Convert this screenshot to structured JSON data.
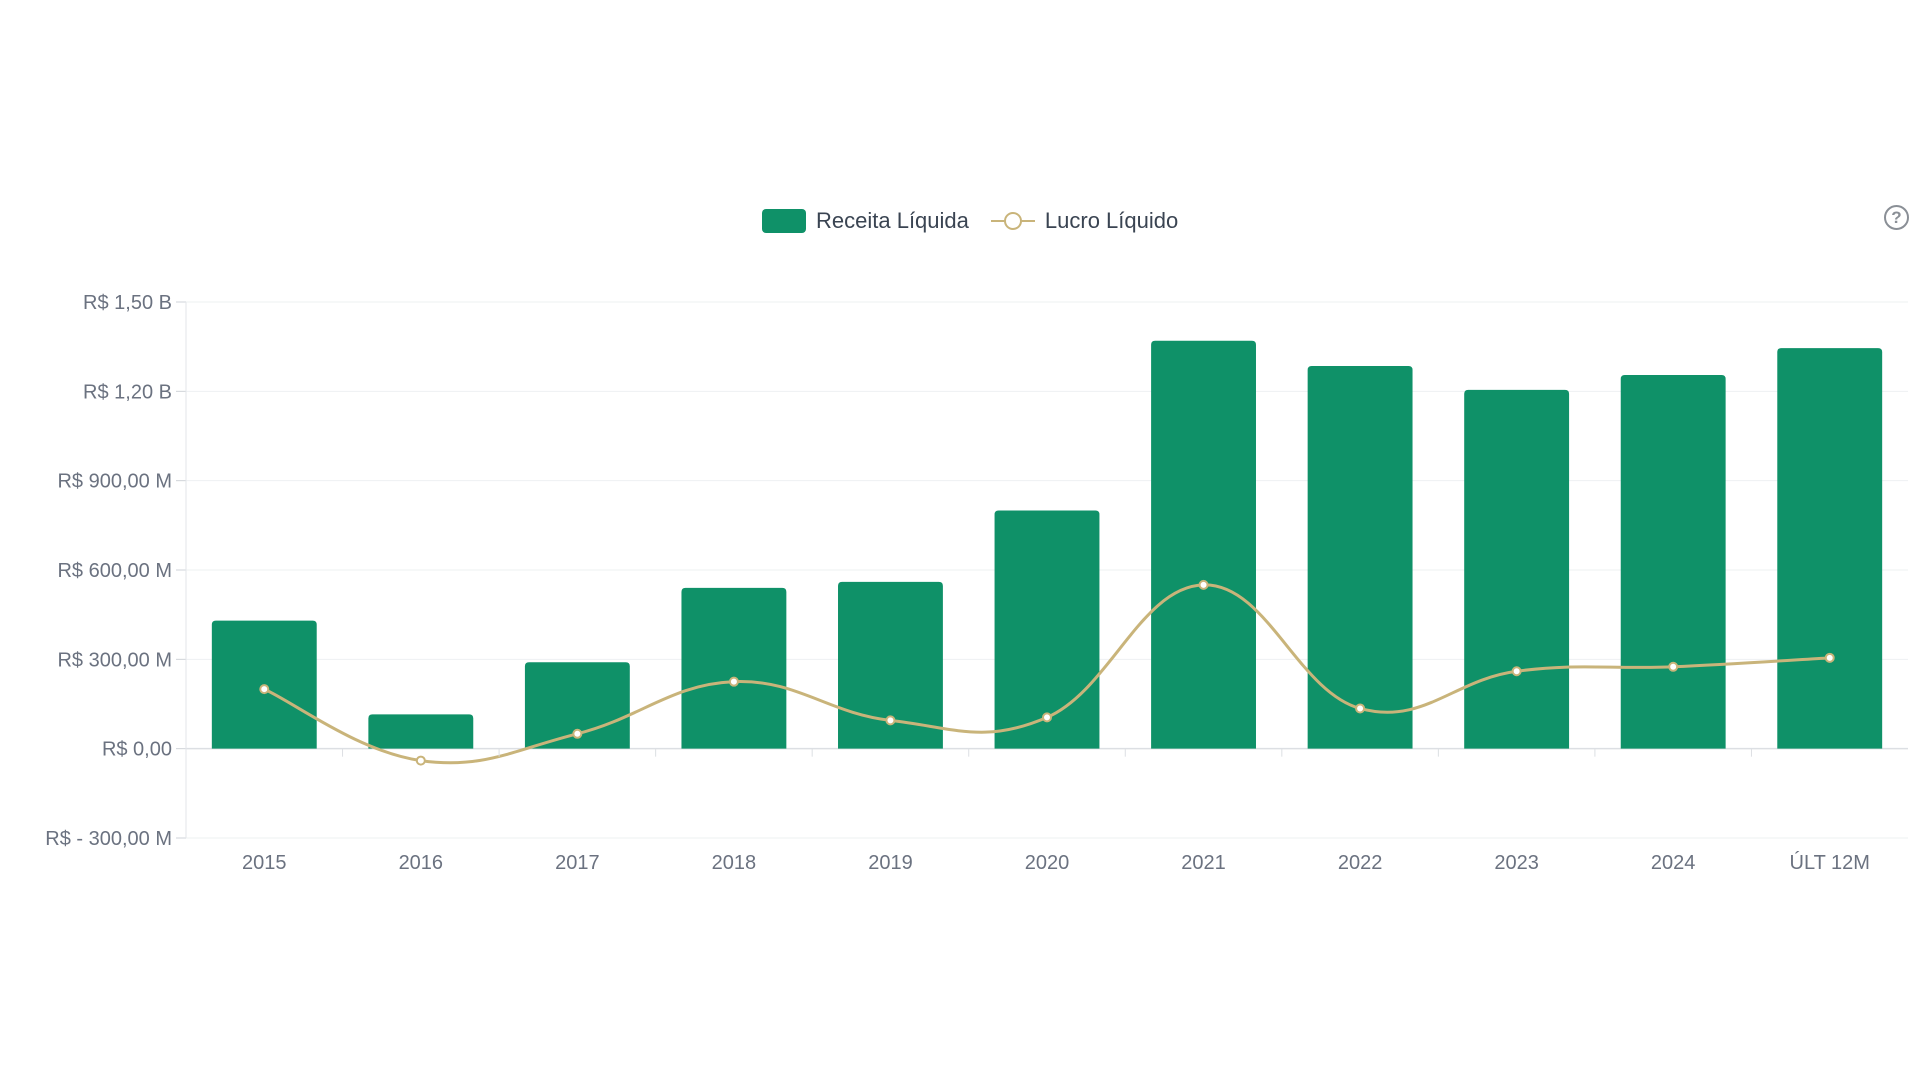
{
  "legend": {
    "bar_label": "Receita Líquida",
    "line_label": "Lucro Líquido"
  },
  "help_icon": "?",
  "colors": {
    "bar": "#0f9168",
    "line": "#c9b47a",
    "grid": "#eef0f2",
    "axis_text": "#6b7280"
  },
  "chart_data": {
    "type": "bar",
    "categories": [
      "2015",
      "2016",
      "2017",
      "2018",
      "2019",
      "2020",
      "2021",
      "2022",
      "2023",
      "2024",
      "ÚLT 12M"
    ],
    "series": [
      {
        "name": "Receita Líquida",
        "type": "bar",
        "values": [
          430000000,
          115000000,
          290000000,
          540000000,
          560000000,
          800000000,
          1370000000,
          1285000000,
          1205000000,
          1255000000,
          1345000000
        ]
      },
      {
        "name": "Lucro Líquido",
        "type": "line",
        "values": [
          200000000,
          -40000000,
          50000000,
          225000000,
          95000000,
          105000000,
          550000000,
          135000000,
          260000000,
          275000000,
          305000000
        ]
      }
    ],
    "ylim": [
      -300000000,
      1500000000
    ],
    "yticks": [
      {
        "value": 1500000000,
        "label": "R$  1,50 B"
      },
      {
        "value": 1200000000,
        "label": "R$  1,20 B"
      },
      {
        "value": 900000000,
        "label": "R$  900,00 M"
      },
      {
        "value": 600000000,
        "label": "R$  600,00 M"
      },
      {
        "value": 300000000,
        "label": "R$  300,00 M"
      },
      {
        "value": 0,
        "label": "R$ 0,00"
      },
      {
        "value": -300000000,
        "label": "R$ - 300,00 M"
      }
    ],
    "title": "",
    "xlabel": "",
    "ylabel": "",
    "grid": true,
    "legend_position": "top-center"
  }
}
